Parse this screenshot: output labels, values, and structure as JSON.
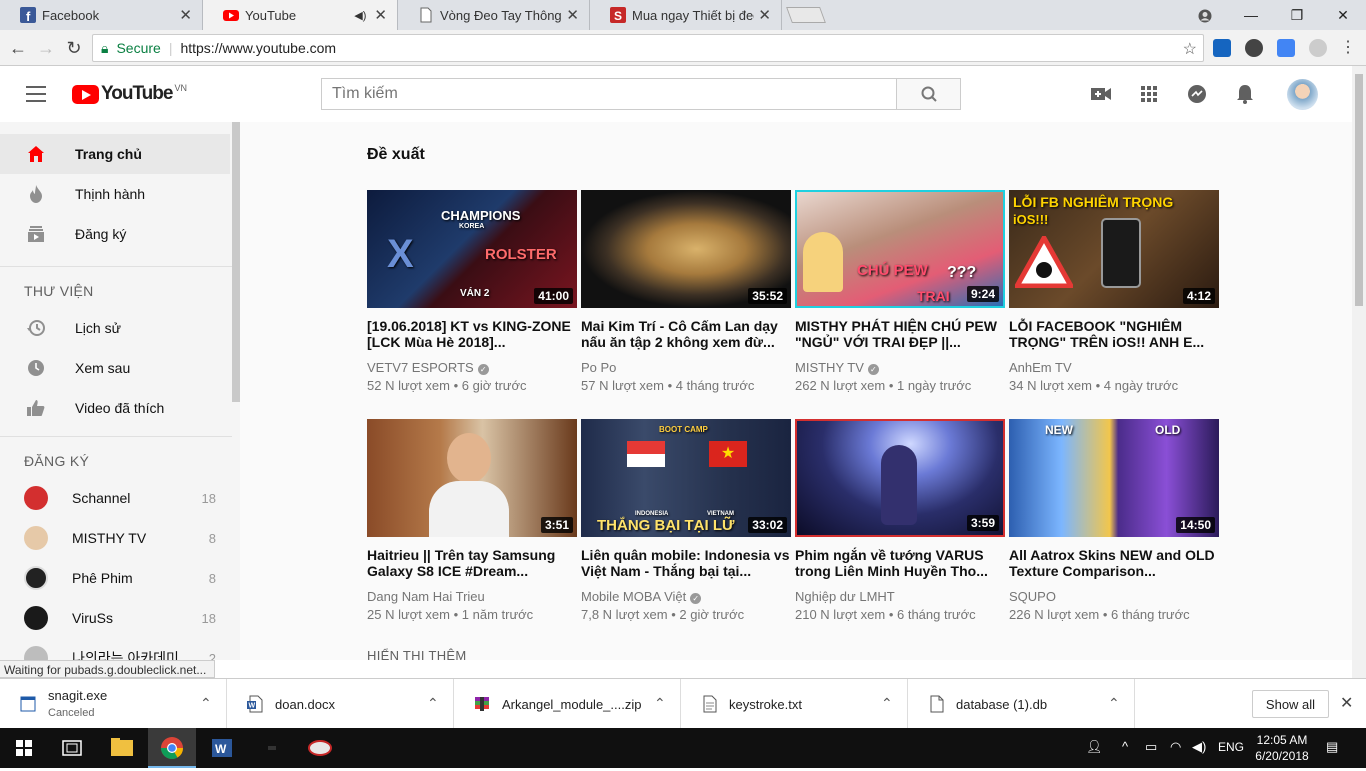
{
  "browser": {
    "tabs": [
      {
        "label": "Facebook",
        "icon": "facebook-icon",
        "active": false
      },
      {
        "label": "YouTube",
        "icon": "youtube-icon",
        "active": true
      },
      {
        "label": "Vòng Đeo Tay Thông Minh",
        "icon": "document-icon",
        "active": false
      },
      {
        "label": "Mua ngay Thiết bị đeo th",
        "icon": "shop-icon",
        "active": false
      }
    ],
    "secure_label": "Secure",
    "url": "https://www.youtube.com",
    "status_text": "Waiting for pubads.g.doubleclick.net..."
  },
  "youtube": {
    "logo_text": "YouTube",
    "logo_region": "VN",
    "search_placeholder": "Tìm kiếm",
    "sidebar": {
      "main_items": [
        {
          "label": "Trang chủ",
          "icon": "home-icon",
          "active": true
        },
        {
          "label": "Thịnh hành",
          "icon": "fire-icon",
          "active": false
        },
        {
          "label": "Đăng ký",
          "icon": "subscriptions-icon",
          "active": false
        }
      ],
      "library_heading": "THƯ VIỆN",
      "library_items": [
        {
          "label": "Lịch sử",
          "icon": "history-icon"
        },
        {
          "label": "Xem sau",
          "icon": "clock-icon"
        },
        {
          "label": "Video đã thích",
          "icon": "thumbs-up-icon"
        }
      ],
      "subs_heading": "ĐĂNG KÝ",
      "subscriptions": [
        {
          "name": "Schannel",
          "count": "18",
          "color": "#d32f2f"
        },
        {
          "name": "MISTHY TV",
          "count": "8",
          "color": "#e6c9a8"
        },
        {
          "name": "Phê Phim",
          "count": "8",
          "color": "#222222"
        },
        {
          "name": "ViruSs",
          "count": "18",
          "color": "#1a1a1a"
        },
        {
          "name": "나의라는 아카데미",
          "count": "2",
          "color": "#bdbdbd"
        }
      ]
    },
    "section_title": "Đề xuất",
    "videos": [
      {
        "title": "[19.06.2018] KT vs KING-ZONE [LCK Mùa Hè 2018]...",
        "channel": "VETV7 ESPORTS",
        "verified": true,
        "views": "52 N lượt xem",
        "age": "6 giờ trước",
        "duration": "41:00"
      },
      {
        "title": "Mai Kim Trí - Cô Cấm Lan dạy nấu ăn tập 2 không xem đừ...",
        "channel": "Po Po",
        "verified": false,
        "views": "57 N lượt xem",
        "age": "4 tháng trước",
        "duration": "35:52"
      },
      {
        "title": "MISTHY PHÁT HIỆN CHÚ PEW \"NGỦ\" VỚI TRAI ĐẸP ||...",
        "channel": "MISTHY TV",
        "verified": true,
        "views": "262 N lượt xem",
        "age": "1 ngày trước",
        "duration": "9:24"
      },
      {
        "title": "LỖI FACEBOOK \"NGHIÊM TRỌNG\" TRÊN iOS!! ANH E...",
        "channel": "AnhEm TV",
        "verified": false,
        "views": "34 N lượt xem",
        "age": "4 ngày trước",
        "duration": "4:12"
      },
      {
        "title": "Haitrieu || Trên tay Samsung Galaxy S8 ICE #Dream...",
        "channel": "Dang Nam Hai Trieu",
        "verified": false,
        "views": "25 N lượt xem",
        "age": "1 năm trước",
        "duration": "3:51"
      },
      {
        "title": "Liên quân mobile: Indonesia vs Việt Nam - Thắng bại tại...",
        "channel": "Mobile MOBA Việt",
        "verified": true,
        "views": "7,8 N lượt xem",
        "age": "2 giờ trước",
        "duration": "33:02"
      },
      {
        "title": "Phim ngắn về tướng VARUS trong Liên Minh Huyền Tho...",
        "channel": "Nghiệp dư LMHT",
        "verified": false,
        "views": "210 N lượt xem",
        "age": "6 tháng trước",
        "duration": "3:59"
      },
      {
        "title": "All Aatrox Skins NEW and OLD Texture Comparison...",
        "channel": "SQUPO",
        "verified": false,
        "views": "226 N lượt xem",
        "age": "6 tháng trước",
        "duration": "14:50"
      }
    ],
    "thumb_text": {
      "v1_top": "CHAMPIONS",
      "v1_sub": "KOREA",
      "v1_game": "VÁN 2",
      "v1_team": "ROLSTER",
      "v3_text": "CHÚ PEW",
      "v3_q": "???",
      "v3_trai": "TRAI",
      "v4_text": "LỖI FB NGHIÊM TRỌNG",
      "v4_ios": "iOS!!!",
      "v6_top": "BOOT CAMP",
      "v6_bottom": "THẮNG BẠI TẠI LỮ",
      "v6_left": "INDONESIA",
      "v6_right": "VIETNAM",
      "v8_new": "NEW",
      "v8_old": "OLD"
    },
    "show_more": "HIỂN THỊ THÊM"
  },
  "downloads": {
    "items": [
      {
        "name": "snagit.exe",
        "sub": "Canceled",
        "icon": "exe-icon"
      },
      {
        "name": "doan.docx",
        "sub": "",
        "icon": "word-doc-icon"
      },
      {
        "name": "Arkangel_module_....zip",
        "sub": "",
        "icon": "zip-icon"
      },
      {
        "name": "keystroke.txt",
        "sub": "",
        "icon": "text-file-icon"
      },
      {
        "name": "database (1).db",
        "sub": "",
        "icon": "file-icon"
      }
    ],
    "show_all": "Show all"
  },
  "taskbar": {
    "language": "ENG",
    "time": "12:05 AM",
    "date": "6/20/2018"
  }
}
